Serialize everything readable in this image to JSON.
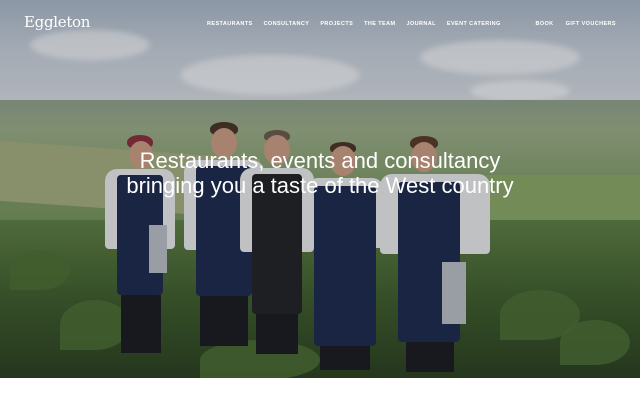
{
  "brand": {
    "logo_text": "Eggleton"
  },
  "nav": {
    "links": [
      "RESTAURANTS",
      "CONSULTANCY",
      "PROJECTS",
      "THE TEAM",
      "JOURNAL",
      "EVENT CATERING"
    ],
    "right_links": [
      "BOOK",
      "GIFT VOUCHERS"
    ]
  },
  "hero": {
    "headline": "Restaurants, events and consultancy bringing you a taste of the West country",
    "image": "chefs-in-garden-photo"
  },
  "colors": {
    "text_on_image": "#ffffff",
    "apron": "#1e2a4d",
    "background": "#ffffff"
  }
}
